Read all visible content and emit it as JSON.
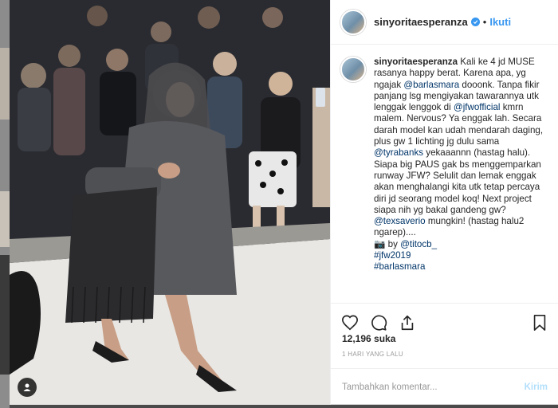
{
  "post": {
    "username": "sinyoritaesperanza",
    "follow_label": "Ikuti",
    "dot": "•",
    "caption": {
      "username": "sinyoritaesperanza",
      "part1": " Kali ke 4 jd MUSE rasanya happy berat. Karena apa, yg ngajak ",
      "mention1": "@barlasmara",
      "part2": " dooonk. Tanpa fikir panjang lsg mengiyakan tawarannya utk lenggak lenggok di ",
      "mention2": "@jfwofficial",
      "part3": " kmrn malem. Nervous? Ya enggak lah. Secara darah model kan udah mendarah daging, plus gw 1 lichting jg dulu sama ",
      "mention3": "@tyrabanks",
      "part4": " yekaaannn (hastag halu). Siapa big PAUS gak bs menggemparkan runway JFW? Selulit dan lemak enggak akan menghalangi kita utk tetap percaya diri jd seorang model koq! Next project siapa nih yg bakal gandeng gw? ",
      "mention4": "@texsaverio",
      "part5": " mungkin! (hastag halu2 ngarep)....",
      "camera_emoji": "📷",
      "by_label": " by ",
      "mention5": "@titocb_",
      "hashtag1": "#jfw2019",
      "hashtag2": "#barlasmara"
    },
    "likes": "12,196 suka",
    "time": "1 HARI YANG LALU",
    "comment_placeholder": "Tambahkan komentar...",
    "post_button": "Kirim"
  },
  "icons": {
    "like": "heart-icon",
    "comment": "comment-icon",
    "share": "share-icon",
    "save": "bookmark-icon",
    "verified": "verified-badge-icon",
    "user_tag": "user-tag-icon"
  },
  "colors": {
    "link": "#003569",
    "accent": "#3897f0",
    "post_button_disabled": "#b2dffc"
  }
}
